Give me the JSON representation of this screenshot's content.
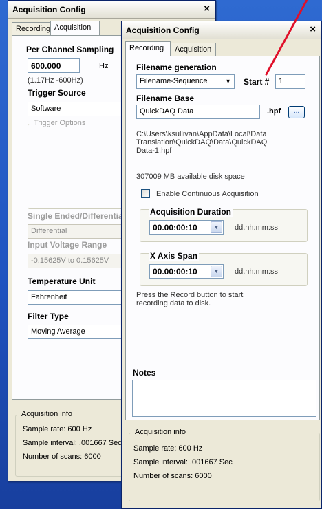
{
  "back_window": {
    "title": "Acquisition Config",
    "close_glyph": "×",
    "tabs": [
      "Recording",
      "Acquisition"
    ],
    "active_tab": "Acquisition",
    "per_channel_sampling_label": "Per Channel Sampling",
    "sampling_value": "600.000",
    "sampling_unit": "Hz",
    "sampling_range": "(1.17Hz -600Hz)",
    "trigger_source_label": "Trigger Source",
    "trigger_source_value": "Software",
    "trigger_options_label": "Trigger Options",
    "single_ended_label": "Single Ended/Differential",
    "single_ended_value": "Differential",
    "input_voltage_label": "Input Voltage Range",
    "input_voltage_value": "-0.15625V to 0.15625V",
    "temperature_unit_label": "Temperature Unit",
    "temperature_unit_value": "Fahrenheit",
    "filter_type_label": "Filter Type",
    "filter_type_value": "Moving Average",
    "acq_info": {
      "title": "Acquisition info",
      "sample_rate": "Sample rate: 600 Hz",
      "sample_interval": "Sample interval: .001667 Sec",
      "number_of_scans": "Number of scans: 6000"
    }
  },
  "front_window": {
    "title": "Acquisition Config",
    "close_glyph": "×",
    "tabs": [
      "Recording",
      "Acquisition"
    ],
    "active_tab": "Recording",
    "filename_generation_label": "Filename generation",
    "filename_generation_value": "Filename-Sequence",
    "start_label": "Start #",
    "start_value": "1",
    "filename_base_label": "Filename Base",
    "filename_base_value": "QuickDAQ Data",
    "extension": ".hpf",
    "browse_label": "...",
    "path_lines": [
      "C:\\Users\\ksullivan\\AppData\\Local\\Data",
      "Translation\\QuickDAQ\\Data\\QuickDAQ",
      "Data-1.hpf"
    ],
    "disk_space": "307009 MB available disk space",
    "continuous_acq_label": "Enable Continuous Acquisition",
    "continuous_acq_checked": false,
    "acq_duration_label": "Acquisition Duration",
    "acq_duration_value": "00.00:00:10",
    "acq_duration_format": "dd.hh:mm:ss",
    "x_axis_span_label": "X Axis Span",
    "x_axis_span_value": "00.00:00:10",
    "x_axis_span_format": "dd.hh:mm:ss",
    "record_hint_lines": [
      "Press the Record button to start",
      "recording data to disk."
    ],
    "notes_label": "Notes",
    "notes_value": "",
    "acq_info": {
      "title": "Acquisition info",
      "sample_rate": "Sample rate: 600 Hz",
      "sample_interval": "Sample interval: .001667 Sec",
      "number_of_scans": "Number of scans: 6000"
    }
  },
  "colors": {
    "desktop": "#2058c8",
    "window_bg": "#ece9d8",
    "annotation_arrow": "#e0102a"
  },
  "icons": {
    "dropdown": "triangle-down-icon",
    "stepper": "chevron-down-icon",
    "close": "close-icon"
  }
}
